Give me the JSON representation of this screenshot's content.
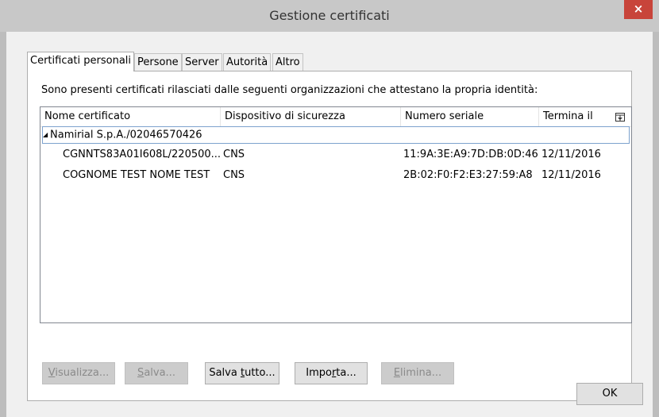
{
  "window": {
    "title": "Gestione certificati",
    "close_glyph": "×"
  },
  "tabs": [
    {
      "label": "Certificati personali",
      "active": true
    },
    {
      "label": "Persone",
      "active": false
    },
    {
      "label": "Server",
      "active": false
    },
    {
      "label": "Autorità",
      "active": false
    },
    {
      "label": "Altro",
      "active": false
    }
  ],
  "intro_text": "Sono presenti certificati rilasciati dalle seguenti organizzazioni che attestano la propria identità:",
  "table": {
    "columns": [
      "Nome certificato",
      "Dispositivo di sicurezza",
      "Numero seriale",
      "Termina il"
    ],
    "column_picker_icon": "column-picker-icon",
    "group": {
      "expander": "◢",
      "label": "Namirial S.p.A./02046570426"
    },
    "rows": [
      [
        "CGNNTS83A01I608L/220500...",
        "CNS",
        "11:9A:3E:A9:7D:DB:0D:46",
        "12/11/2016"
      ],
      [
        "COGNOME TEST NOME TEST",
        "CNS",
        "2B:02:F0:F2:E3:27:59:A8",
        "12/11/2016"
      ]
    ]
  },
  "buttons": {
    "view": {
      "pre": "",
      "key": "V",
      "post": "isualizza...",
      "enabled": false
    },
    "save": {
      "pre": "",
      "key": "S",
      "post": "alva...",
      "enabled": false
    },
    "save_all": {
      "pre": "Salva ",
      "key": "t",
      "post": "utto...",
      "enabled": true
    },
    "import": {
      "pre": "Impo",
      "key": "r",
      "post": "ta...",
      "enabled": true
    },
    "delete": {
      "pre": "",
      "key": "E",
      "post": "limina...",
      "enabled": false
    }
  },
  "ok_label": "OK"
}
